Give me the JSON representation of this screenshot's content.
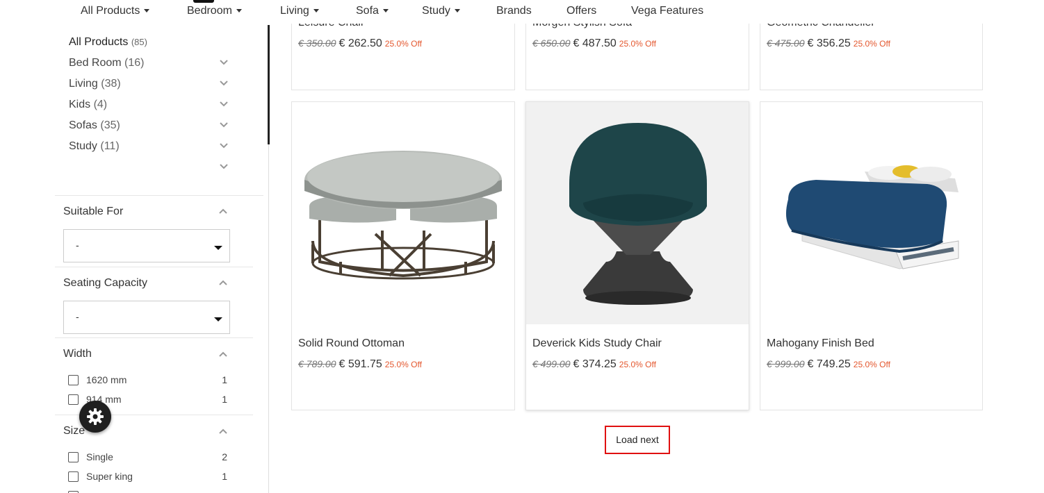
{
  "nav": {
    "items": [
      {
        "label": "All Products",
        "dropdown": true
      },
      {
        "label": "Bedroom",
        "dropdown": true
      },
      {
        "label": "Living",
        "dropdown": true
      },
      {
        "label": "Sofa",
        "dropdown": true
      },
      {
        "label": "Study",
        "dropdown": true
      },
      {
        "label": "Brands",
        "dropdown": false
      },
      {
        "label": "Offers",
        "dropdown": false
      },
      {
        "label": "Vega Features",
        "dropdown": false
      }
    ]
  },
  "sidebar": {
    "categories": [
      {
        "label": "All Products",
        "count": "(85)"
      },
      {
        "label": "Bed Room",
        "count": "(16)"
      },
      {
        "label": "Living",
        "count": "(38)"
      },
      {
        "label": "Kids",
        "count": "(4)"
      },
      {
        "label": "Sofas",
        "count": "(35)"
      },
      {
        "label": "Study",
        "count": "(11)"
      }
    ],
    "filters": {
      "suitable_for": {
        "title": "Suitable For",
        "selected": "-"
      },
      "seating_capacity": {
        "title": "Seating Capacity",
        "selected": "-"
      },
      "width": {
        "title": "Width",
        "options": [
          {
            "label": "1620 mm",
            "count": "1"
          },
          {
            "label": "914 mm",
            "count": "1"
          }
        ]
      },
      "size": {
        "title": "Size",
        "options": [
          {
            "label": "Single",
            "count": "2"
          },
          {
            "label": "Super king",
            "count": "1"
          }
        ]
      }
    }
  },
  "products_top": [
    {
      "name": "Leisure Chair",
      "old_price": "€ 350.00",
      "new_price": "€ 262.50",
      "discount": "25.0% Off"
    },
    {
      "name": "Morgen Stylish Sofa",
      "old_price": "€ 650.00",
      "new_price": "€ 487.50",
      "discount": "25.0% Off"
    },
    {
      "name": "Geometric Chandelier",
      "old_price": "€ 475.00",
      "new_price": "€ 356.25",
      "discount": "25.0% Off"
    }
  ],
  "products": [
    {
      "name": "Solid Round Ottoman",
      "old_price": "€ 789.00",
      "new_price": "€ 591.75",
      "discount": "25.0% Off",
      "image": "round-ottoman-image"
    },
    {
      "name": "Deverick Kids Study Chair",
      "old_price": "€ 499.00",
      "new_price": "€ 374.25",
      "discount": "25.0% Off",
      "image": "study-chair-image"
    },
    {
      "name": "Mahogany Finish Bed",
      "old_price": "€ 999.00",
      "new_price": "€ 749.25",
      "discount": "25.0% Off",
      "image": "bed-image"
    }
  ],
  "load_next": {
    "label": "Load next"
  },
  "colors": {
    "accent_discount": "#e4572e",
    "load_next_border": "#e01010"
  }
}
